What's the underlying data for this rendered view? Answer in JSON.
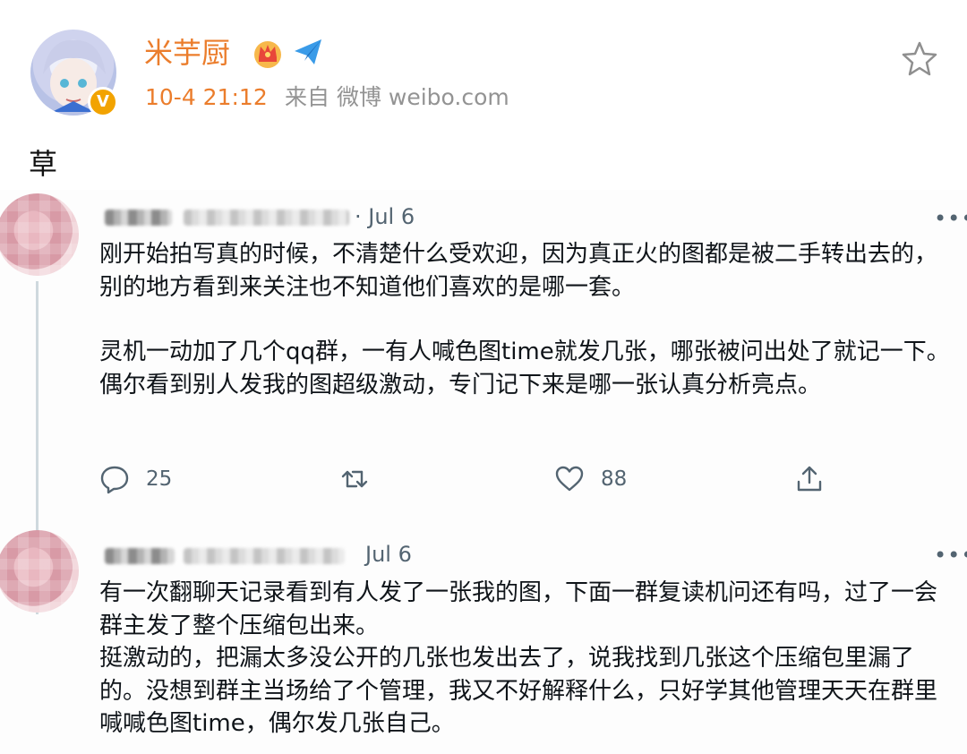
{
  "weibo": {
    "username": "米芋厨",
    "time": "10-4 21:12",
    "source": "来自 微博 weibo.com",
    "text": "草",
    "verify_badge": "V",
    "icons": [
      "crown-icon",
      "plane-icon",
      "star-icon",
      "verify-icon"
    ],
    "colors": {
      "accent": "#eb7d2c",
      "muted": "#939393"
    }
  },
  "embedded_tweets": [
    {
      "date": "· Jul 6",
      "more": "•••",
      "paragraphs": [
        "刚开始拍写真的时候，不清楚什么受欢迎，因为真正火的图都是被二手转出去的，别的地方看到来关注也不知道他们喜欢的是哪一套。",
        "灵机一动加了几个qq群，一有人喊色图time就发几张，哪张被问出处了就记一下。偶尔看到别人发我的图超级激动，专门记下来是哪一张认真分析亮点。"
      ],
      "actions": {
        "reply_count": "25",
        "like_count": "88"
      }
    },
    {
      "date": "Jul 6",
      "more": "•••",
      "paragraphs": [
        "有一次翻聊天记录看到有人发了一张我的图，下面一群复读机问还有吗，过了一会群主发了整个压缩包出来。",
        "挺激动的，把漏太多没公开的几张也发出去了，说我找到几张这个压缩包里漏了的。没想到群主当场给了个管理，我又不好解释什么，只好学其他管理天天在群里喊喊色图time，偶尔发几张自己。"
      ]
    }
  ]
}
